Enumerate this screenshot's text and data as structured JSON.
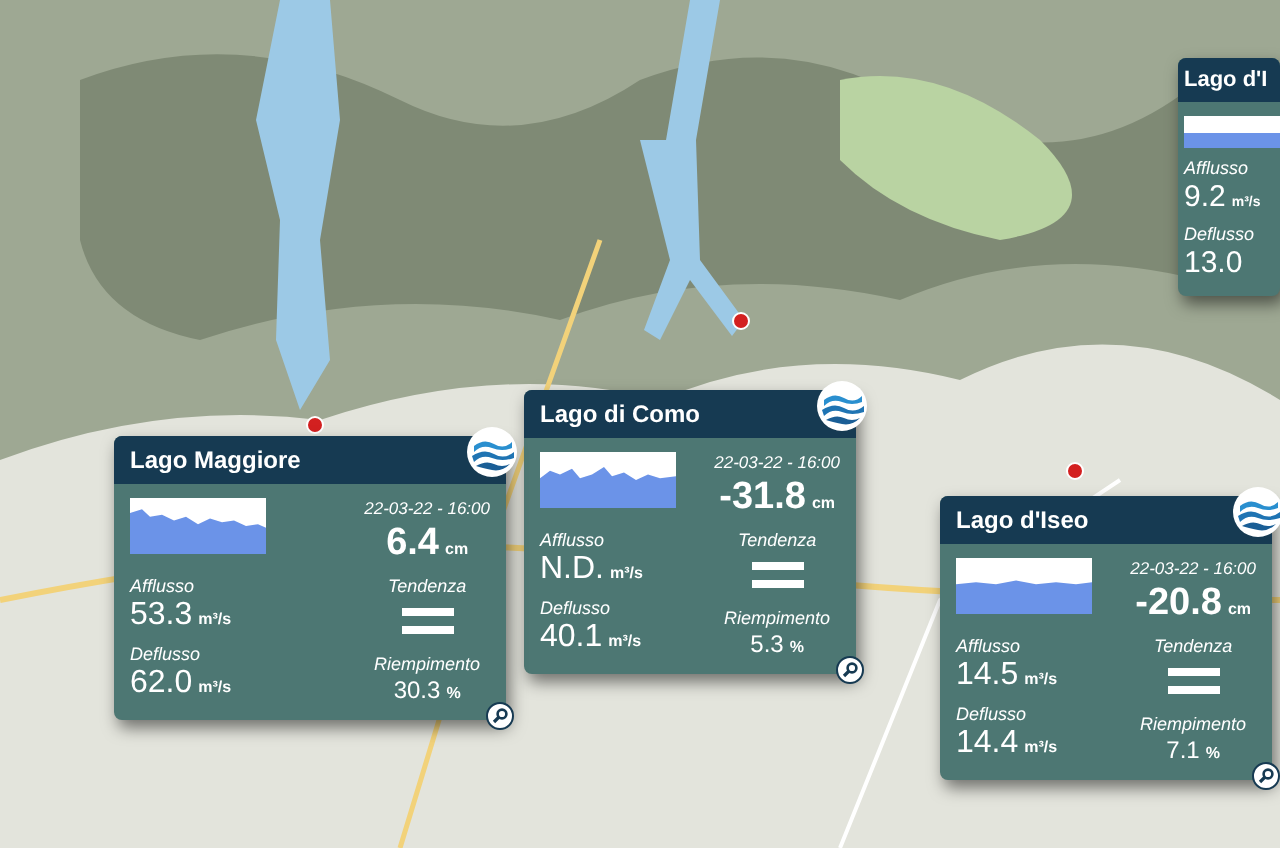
{
  "lakes": [
    {
      "name": "Lago d'I",
      "inflow_label": "Afflusso",
      "inflow": "9.2",
      "inflow_unit": "m³/s",
      "outflow_label": "Deflusso",
      "outflow": "13.0"
    },
    {
      "name": "Lago di Como",
      "timestamp": "22-03-22 - 16:00",
      "level": "-31.8",
      "level_unit": "cm",
      "inflow_label": "Afflusso",
      "inflow": "N.D.",
      "inflow_unit": "m³/s",
      "outflow_label": "Deflusso",
      "outflow": "40.1",
      "outflow_unit": "m³/s",
      "trend_label": "Tendenza",
      "fill_label": "Riempimento",
      "fill": "5.3",
      "fill_unit": "%"
    },
    {
      "name": "Lago Maggiore",
      "timestamp": "22-03-22 - 16:00",
      "level": "6.4",
      "level_unit": "cm",
      "inflow_label": "Afflusso",
      "inflow": "53.3",
      "inflow_unit": "m³/s",
      "outflow_label": "Deflusso",
      "outflow": "62.0",
      "outflow_unit": "m³/s",
      "trend_label": "Tendenza",
      "fill_label": "Riempimento",
      "fill": "30.3",
      "fill_unit": "%"
    },
    {
      "name": "Lago d'Iseo",
      "timestamp": "22-03-22 - 16:00",
      "level": "-20.8",
      "level_unit": "cm",
      "inflow_label": "Afflusso",
      "inflow": "14.5",
      "inflow_unit": "m³/s",
      "outflow_label": "Deflusso",
      "outflow": "14.4",
      "outflow_unit": "m³/s",
      "trend_label": "Tendenza",
      "fill_label": "Riempimento",
      "fill": "7.1",
      "fill_unit": "%"
    }
  ]
}
